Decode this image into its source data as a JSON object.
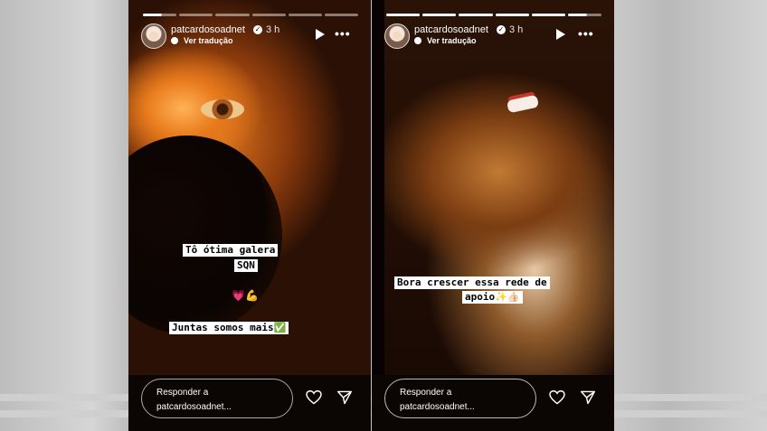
{
  "stories": [
    {
      "username": "patcardosoadnet",
      "time": "3 h",
      "translate_label": "Ver tradução",
      "captions": [
        "Tô ótima galera",
        "SQN",
        "💗💪",
        "Juntas somos mais✅"
      ],
      "reply_line1": "Responder a",
      "reply_line2": "patcardosoadnet...",
      "progress": {
        "segments": 6,
        "current_index": 0
      }
    },
    {
      "username": "patcardosoadnet",
      "time": "3 h",
      "translate_label": "Ver tradução",
      "captions": [
        "Bora crescer essa rede de",
        "apoio✨👍🏻"
      ],
      "reply_line1": "Responder a",
      "reply_line2": "patcardosoadnet...",
      "progress": {
        "segments": 6,
        "current_index": 5
      }
    }
  ],
  "icons": {
    "play": "play-icon",
    "more": "more-options-icon",
    "heart": "heart-icon",
    "send": "send-icon",
    "globe": "globe-icon",
    "verified": "verified-badge-icon"
  }
}
